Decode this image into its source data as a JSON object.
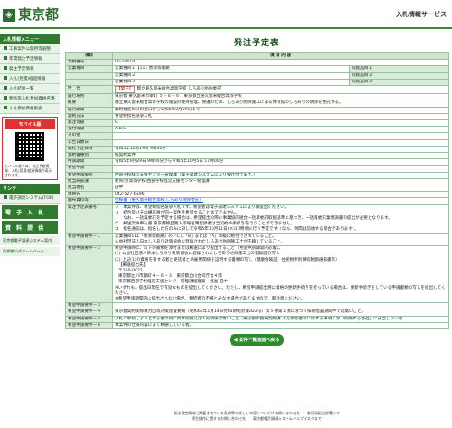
{
  "header": {
    "logo_text": "東京都",
    "service_name": "入札情報サービス"
  },
  "sidebar": {
    "menu_head": "入札情報メニュー",
    "items": [
      "工事案件公開所等調整",
      "年間発注予定情報",
      "発注予定情報",
      "入札(見積)経過情報",
      "入札結果一覧",
      "物品等入札参加資格名簿",
      "入札参加資格照会"
    ],
    "mobile_label": "モバイル版",
    "mobile_note": "モバイル版では、発注予定情報、入札(見積)経過情報が表示されます。",
    "other_head": "リンク",
    "link_items": [
      "電子調達システム(TOP)"
    ],
    "big_links": [
      "電 子 入 札",
      "資 料 提 供"
    ],
    "extra_links": [
      "東京都電子調達システム案内",
      "東京都公式ホームページ"
    ]
  },
  "page_title": "発注予定表",
  "table_header": {
    "item": "項目",
    "content": "項 目 内 容"
  },
  "rows": [
    {
      "k": "契約番号",
      "v": "05-10618"
    },
    {
      "k": "営業種目",
      "v": "営業種目１【111 煮沸等販路",
      "side": "取扱品目１"
    },
    {
      "k": "",
      "v": "営業種目２",
      "side": "取扱品目２"
    },
    {
      "k": "",
      "v": "営業種目３",
      "side": "取扱品目３"
    },
    {
      "k": "件　名",
      "tag": "【電子】",
      "v": "都立東久留米総合高等学校 しろあり防除委託"
    },
    {
      "k": "履行場所",
      "v": "東京都 東久留米市幸町 ５－８－６　東京都立東久留米総合高等学校"
    },
    {
      "k": "概要",
      "v": "都立東久留米総合高等学校の施設の維持管理、保護のため、しろあり防除施工による体育館のしろありの防除を委託する。"
    },
    {
      "k": "履行期間",
      "v": "契約確定の日の翌日から令和6年2月29日まで"
    },
    {
      "k": "契約方法",
      "v": "希望制指名競争入札"
    },
    {
      "k": "発注等級",
      "v": "C"
    },
    {
      "k": "受付等級",
      "v": "A,B,C"
    },
    {
      "k": "その他",
      "v": ""
    },
    {
      "k": "公告日数日",
      "v": ""
    },
    {
      "k": "開札予定日時",
      "v": "令和5年10月19日 9時30分"
    },
    {
      "k": "契約書種別",
      "v": "紙契約案件"
    },
    {
      "k": "申請期間",
      "v": "令和5年9月29日 9時00分から令和5年10月5日 17時00分"
    },
    {
      "k": "希望申請",
      "v": ""
    },
    {
      "k": "希望申請場所",
      "v": "西部学校経営支援センター管理課（電子調達システムにより受け付けます。）"
    },
    {
      "k": "担当局部課",
      "v": "教育庁(高等学校)西部学校経営支援センター管理課"
    },
    {
      "k": "担当者名",
      "v": "田中"
    },
    {
      "k": "連絡先",
      "v": "042-527-6596"
    },
    {
      "k": "配布資料等",
      "v": "仕様書（東久留米総合高校 しろあり防除委託）"
    }
  ],
  "notes": {
    "hatchu_label": "発注予定表備考",
    "hatchu": [
      "ア　本案件は、希望制指名競争入札です。希望者は電子調達システムにより御提出ください。",
      "イ　結合及びその構成員が同一案件を希望することはできません。",
      "　　なお、一括再委託を予定する場合は、希望提出の際に事業協同組合一括再委託取扱基準に基づき、一括再委託業者調書の提出が必要となります。",
      "ウ　郵送案件申込書 東京都物品賞入等報名簿登録者は当契約の手続きを行うことができません。",
      "エ　指名通知は、指名した方のみに対して令和5年10月11日(水)17時頃に行う予定です（なお、時間は前後する場合があります）。"
    ],
    "req1_label": "希望申請要件－１",
    "req1": "営業種目111「煮沸等販路」の「C」、「B」または「A」等級に格付けされていること。",
    "req1b": "公益社団法人日本しろあり対策協会に登録されたしろあり防除施工士が在籍していること。",
    "req2_label": "希望申請要件－２",
    "req2": [
      "希望申請時に、以下の書類を添付または郵送により提出すること（希望申請期間内必着）。",
      "(1) 公益社団法人日本しろあり対策協会に登録されたしろあり防除施工士の登録証の写し",
      "(2) 上記(1)の資格を有する者と受託者との雇用関係を証明する書類の写し（健康保険証、住民税特別徴収税額通知書等）",
      "【郵送提出先】",
      "〒190-0022",
      "東京都立川市錦町４－６－３　東京都立川合同庁舎４階",
      "東京都西部学校経営支援センター管理課経理第一担当 田中",
      "※いずれも、提出日現在で有効なものを提出してください。ただし、希望申請提出時に資格の更新手続きを行っている場合は、更新手続きをしている申請書類の写しを提出してください。",
      "※希望申請期間内に提出されない場合、希望者の不備とみなす場合がありますので、御注意ください。"
    ],
    "req3_label": "希望申請要件－３",
    "req4_label": "希望申請要件－４",
    "req4": "東京都契約関係暴力団等対策措置要綱（昭和62年1月14日付61財経庶第922号）第５条第１項に基づく排除措置期間中では無いこと。",
    "req5_label": "希望申請要件－５",
    "req5": "入札に参加しようとする者の間に資本関係又は人的関係が無いこと（東京都財務局契約課 入札参加者等に関する事項）が「関係する会社」に該当しない者",
    "req6_label": "希望申請要件－６",
    "req6": "本案件の仕様内容によく精通している者。"
  },
  "back_button": "案件一覧画面へ戻る",
  "footer": [
    "発注予定情報に掲載されている条件等の詳しい内容についてはお問い合わせ先　　各局所担当部署まで",
    "原生操作に関するお問い合わせ先　　東京都電子調達システムヘルプデスクまで"
  ]
}
